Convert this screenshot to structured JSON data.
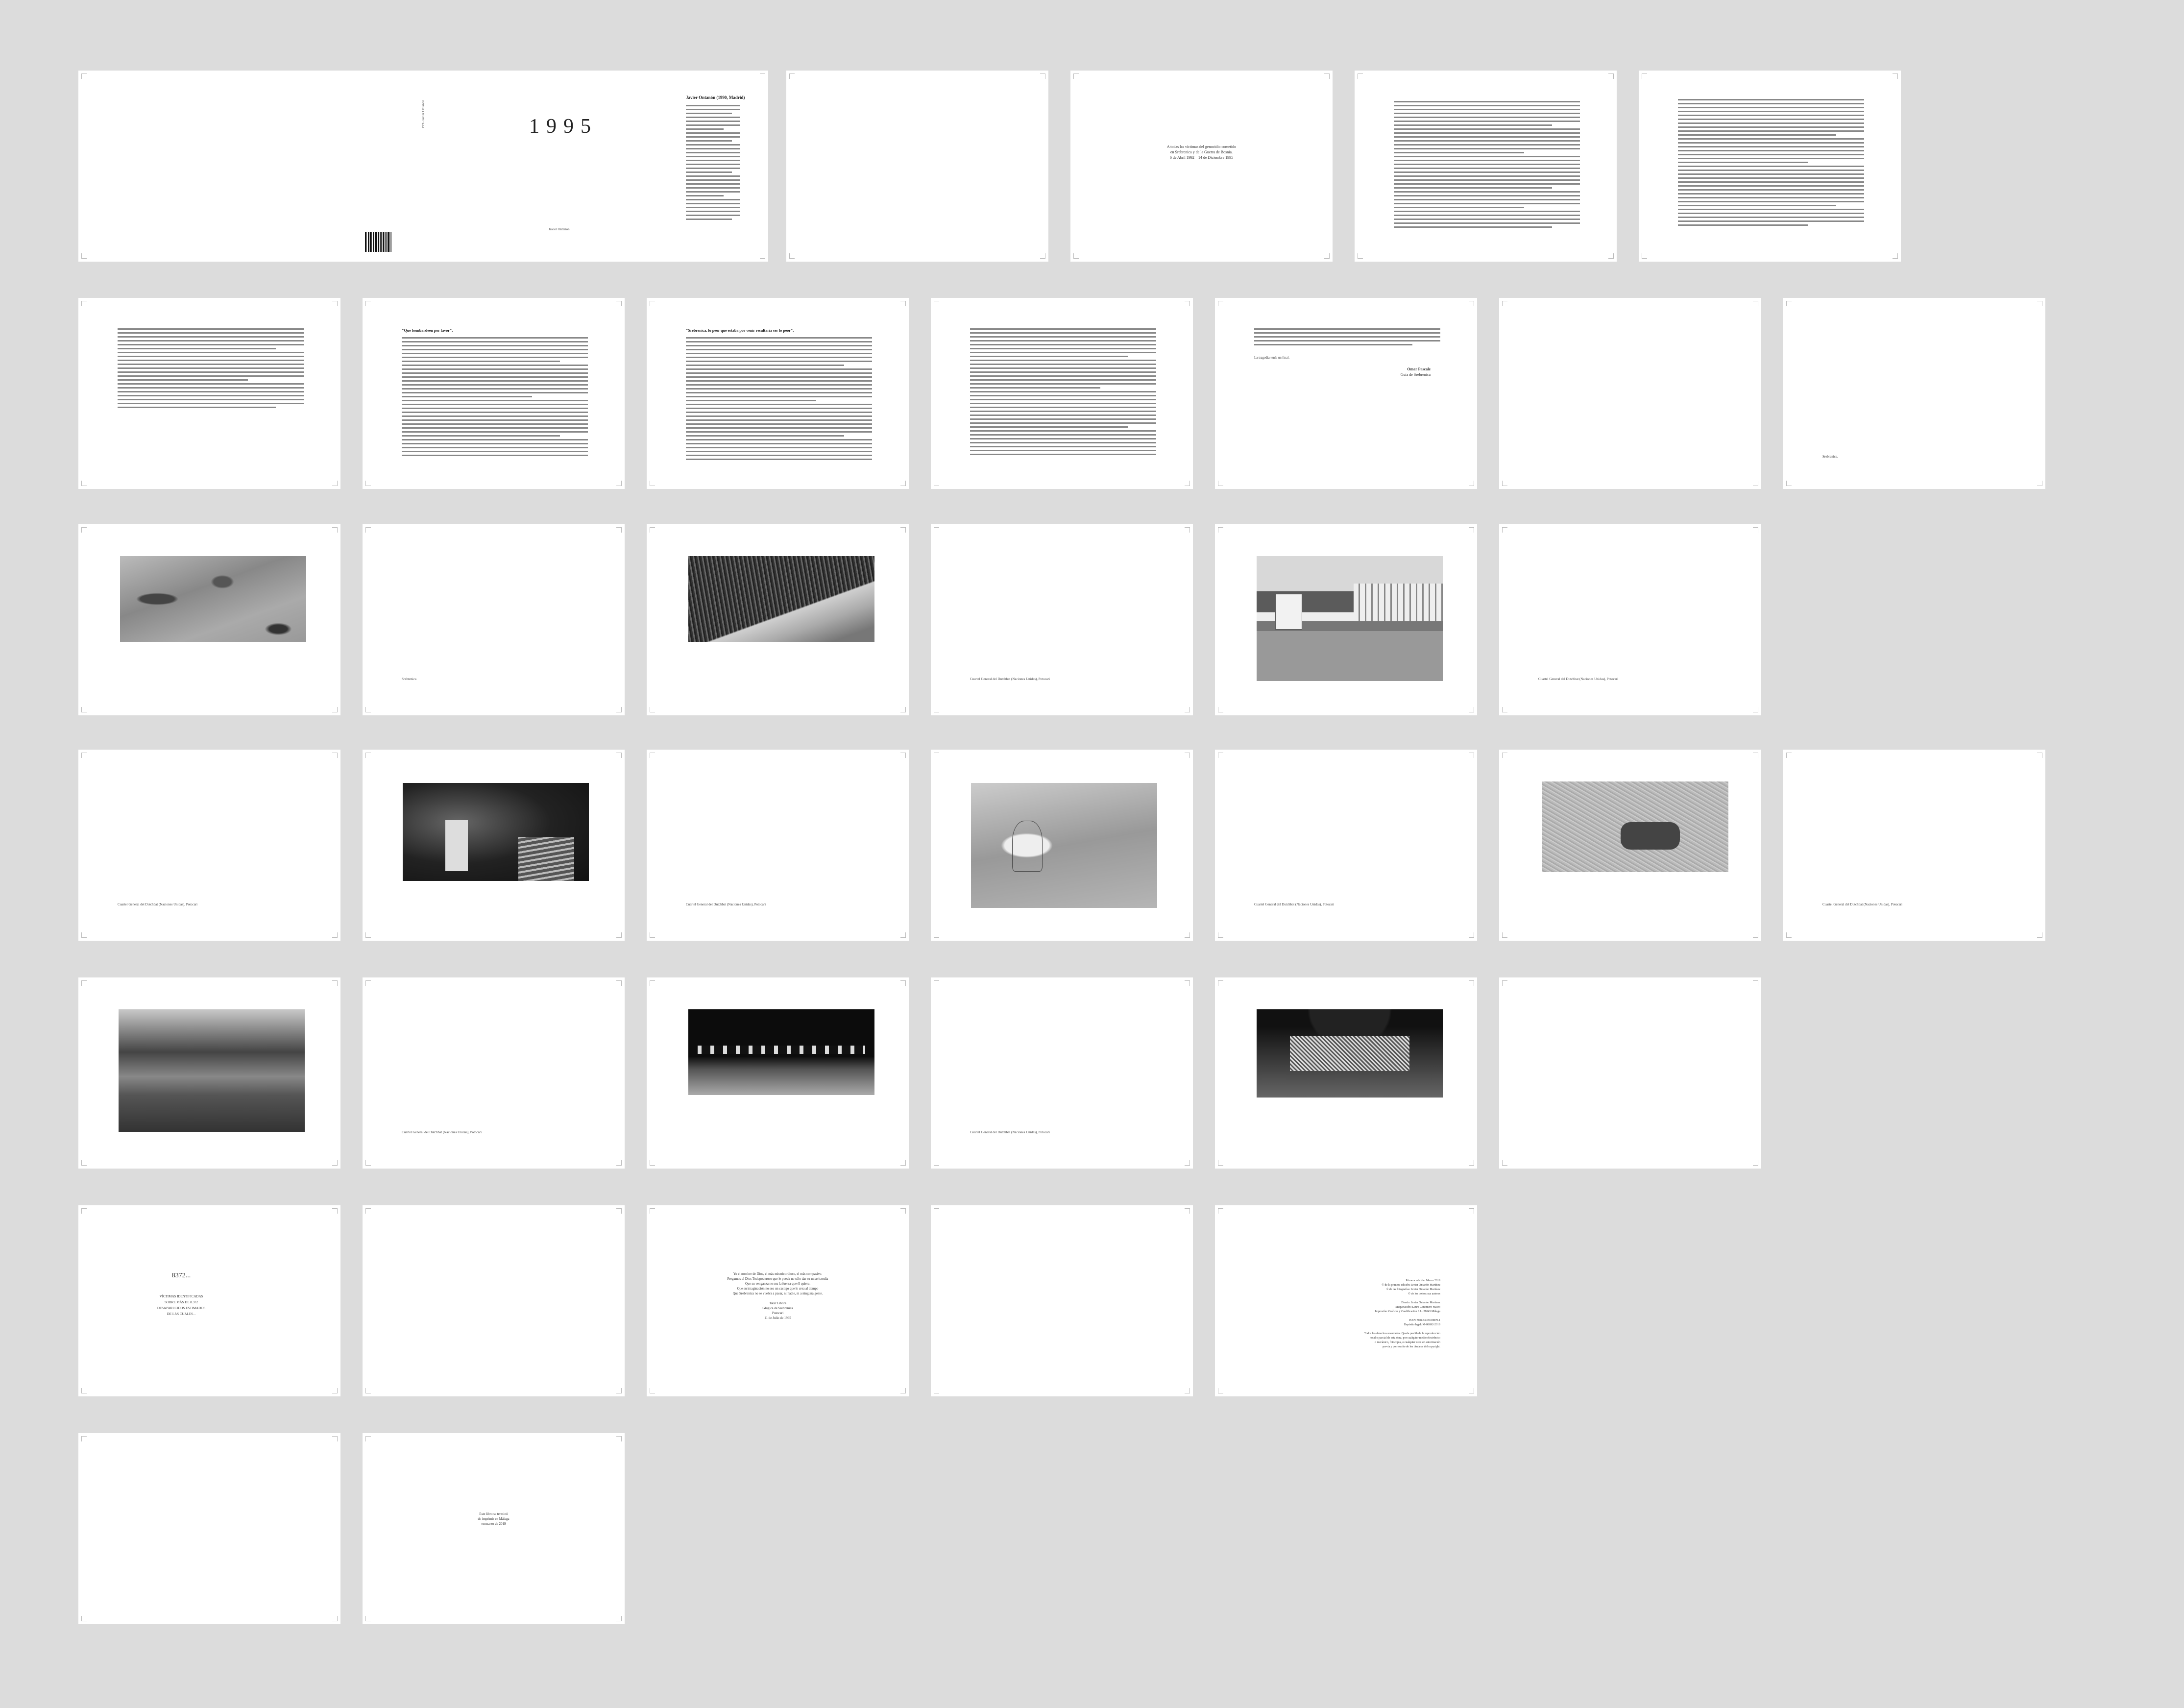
{
  "book": {
    "cover_title": "1995",
    "cover_author": "Javier Ontanón",
    "spine_text": "1995 Javier Ontanón",
    "flap_heading": "Javier Ontanón (1990, Madrid)"
  },
  "dedication": {
    "line1": "A todas las víctimas del genocidio cometido",
    "line2": "en Srebrenica y de la Guerra de Bosnia.",
    "line3": "6 de Abril 1992 – 14 de Diciembre 1995"
  },
  "essay": {
    "quote1": "\"Que bombardeen por favor\".",
    "quote2": "\"Srebrenica, lo peor que estaba por venir resultaría ser lo peor\".",
    "signature_name": "Omar Pascale",
    "signature_role": "Guía de Srebrenica",
    "closing_line": "La tragedia tenía un final.",
    "blank_note": "Srebrenica."
  },
  "captions": {
    "srebrenica": "Srebrenica",
    "barracks": "Cuartel General del Dutchbat (Naciones Unidas), Potocari"
  },
  "colophon": {
    "count_title": "8372...",
    "count_lines": [
      "VÍCTIMAS IDENTIFICADAS",
      "SOBRE MÁS DE 8.372",
      "DESAPARECIDOS ESTIMADOS",
      "DE LAS CUALES..."
    ],
    "poem_lines": [
      "Yo el nombre de Dios, el más misericordioso, el más compasivo.",
      "Pregamos al Dios Todopoderoso que le pueda no sólo dar su misericordia",
      "Que su venganza no sea la fuerza que él quiere.",
      "Que su imaginación no sea un castigo que le crea al tiempo",
      "Que Srebrenica no se vuelva a pasar, ni nadie, ni a ninguna gente."
    ],
    "poem_signature": [
      "Tatar Libora",
      "Glúgica de Srebrenica",
      "Potocari",
      "11 de Julio de 1995"
    ],
    "edition_lines": [
      "Primera edición: Marzo 2019",
      "© de la primera edición: Javier Ontanón Martínez",
      "© de las fotografías: Javier Ontanón Martínez",
      "© de los textos: sus autores",
      "",
      "Diseño: Javier Ontanón Martínez",
      "Maquetación: Laura Canomero Mateo",
      "Impresión: Gráficas y Cualificación S.L. 28045 Málaga",
      "",
      "ISBN: 978-84-09-09879-1",
      "Depósito legal: M-08692-2019",
      "",
      "Todos los derechos reservados. Queda prohibida la reproducción",
      "total o parcial de esta obra, por cualquier medio electrónico",
      "o mecánico, fotocopia, o cualquier otro sin autorización",
      "previa y por escrito de los titulares del copyright."
    ],
    "final_lines": [
      "Este libro se terminó",
      "de imprimir en Málaga",
      "en marzo de 2019"
    ]
  },
  "icons": {
    "crop_mark": "crop-mark-icon"
  }
}
